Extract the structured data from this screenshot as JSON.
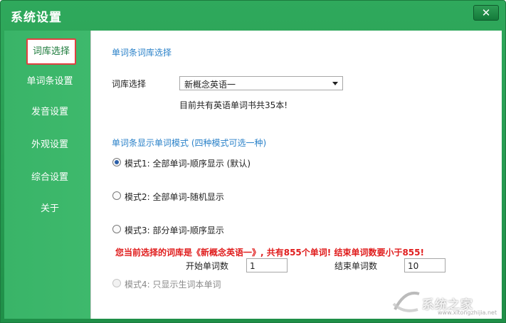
{
  "window": {
    "title": "系统设置",
    "close_symbol": "✕"
  },
  "sidebar": {
    "items": [
      {
        "label": "词库选择",
        "active": true
      },
      {
        "label": "单词条设置"
      },
      {
        "label": "发音设置"
      },
      {
        "label": "外观设置"
      },
      {
        "label": "综合设置"
      },
      {
        "label": "关于"
      }
    ]
  },
  "content": {
    "section1_title": "单词条词库选择",
    "lexicon_label": "词库选择",
    "lexicon_value": "新概念英语一",
    "book_count_text": "目前共有英语单词书共35本!",
    "section2_title": "单词条显示单词模式 (四种模式可选一种)",
    "modes": [
      {
        "label": "模式1: 全部单词-顺序显示 (默认)",
        "checked": true
      },
      {
        "label": "模式2: 全部单词-随机显示",
        "checked": false
      },
      {
        "label": "模式3: 部分单词-顺序显示",
        "checked": false
      },
      {
        "label": "模式4: 只显示生词本单词",
        "checked": false,
        "disabled": true
      }
    ],
    "warning": "您当前选择的词库是《新概念英语一》, 共有855个单词! 结束单词数要小于855!",
    "start_label": "开始单词数",
    "start_value": "1",
    "end_label": "结束单词数",
    "end_value": "10"
  },
  "watermark": {
    "text": "系统之家",
    "url": "www.xitongzhijia.net"
  },
  "colors": {
    "frame_green": "#2fa95c",
    "sidebar_green": "#3eb96c",
    "section_blue": "#2b82c9",
    "warning_red": "#e01d1d",
    "active_border": "#e04040"
  }
}
